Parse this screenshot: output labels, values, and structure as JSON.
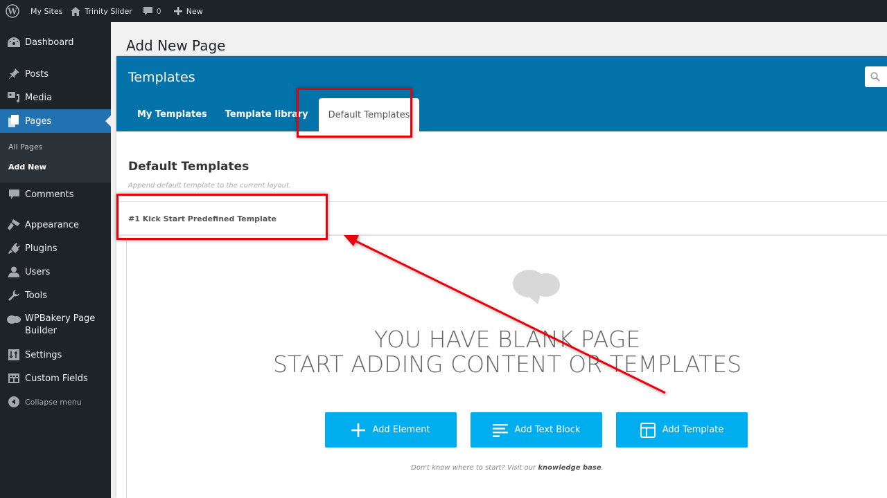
{
  "adminbar": {
    "wp_logo": "wordpress-logo-icon",
    "my_sites": "My Sites",
    "site_name": "Trinity Slider",
    "comments_count": "0",
    "new_label": "New"
  },
  "sidebar": {
    "items": [
      {
        "label": "Dashboard",
        "icon": "dashboard-icon"
      },
      {
        "label": "Posts",
        "icon": "pin-icon"
      },
      {
        "label": "Media",
        "icon": "media-icon"
      },
      {
        "label": "Pages",
        "icon": "pages-icon",
        "active": true
      },
      {
        "label": "Comments",
        "icon": "comment-icon"
      },
      {
        "label": "Appearance",
        "icon": "paintbrush-icon"
      },
      {
        "label": "Plugins",
        "icon": "plugin-icon"
      },
      {
        "label": "Users",
        "icon": "user-icon"
      },
      {
        "label": "Tools",
        "icon": "wrench-icon"
      },
      {
        "label": "WPBakery Page Builder",
        "icon": "wpbakery-icon"
      },
      {
        "label": "Settings",
        "icon": "settings-icon"
      },
      {
        "label": "Custom Fields",
        "icon": "custom-fields-icon"
      }
    ],
    "submenu": [
      "All Pages",
      "Add New"
    ],
    "collapse_label": "Collapse menu"
  },
  "page": {
    "title": "Add New Page"
  },
  "modal": {
    "title": "Templates",
    "search_icon": "search-icon",
    "tabs": [
      "My Templates",
      "Template library",
      "Default Templates"
    ],
    "active_tab": "Default Templates",
    "section_title": "Default Templates",
    "section_desc": "Append default template to the current layout.",
    "templates": [
      "#1 Kick Start Predefined Template"
    ]
  },
  "blank": {
    "line1": "YOU HAVE BLANK PAGE",
    "line2": "START ADDING CONTENT OR TEMPLATES",
    "buttons": [
      {
        "label": "Add Element",
        "icon": "plus-icon"
      },
      {
        "label": "Add Text Block",
        "icon": "text-lines-icon"
      },
      {
        "label": "Add Template",
        "icon": "template-layout-icon"
      }
    ],
    "help_prefix": "Don't know where to start? Visit our ",
    "help_link": "knowledge base",
    "help_suffix": "."
  },
  "colors": {
    "adminbar_bg": "#1d2327",
    "active_menu": "#2271b1",
    "modal_header": "#0473aa",
    "action_button": "#00aeef",
    "annotation": "#e8000b"
  }
}
